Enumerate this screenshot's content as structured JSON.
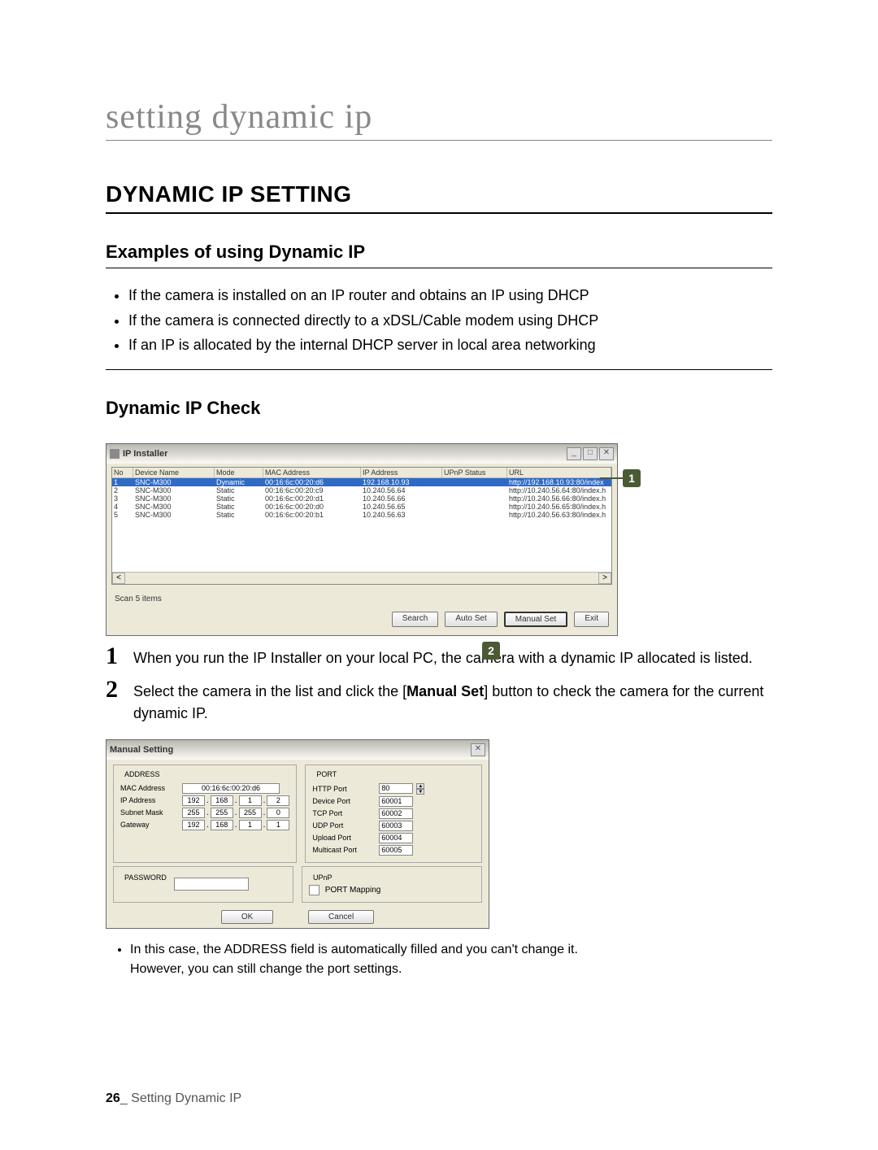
{
  "chapter_title": "setting dynamic ip",
  "section_heading": "DYNAMIC IP SETTING",
  "examples": {
    "heading": "Examples of using Dynamic IP",
    "items": [
      "If the camera is installed on an IP router and obtains an IP using DHCP",
      "If the camera is connected directly to a xDSL/Cable modem using DHCP",
      "If an IP is allocated by the internal DHCP server in local area networking"
    ]
  },
  "dynamic_check_heading": "Dynamic IP Check",
  "installer": {
    "title": "IP Installer",
    "headers": [
      "No",
      "Device Name",
      "Mode",
      "MAC Address",
      "IP Address",
      "UPnP Status",
      "URL"
    ],
    "rows": [
      {
        "no": "1",
        "name": "SNC-M300",
        "mode": "Dynamic",
        "mac": "00:16:6c:00:20:d6",
        "ip": "192.168.10.93",
        "upnp": "",
        "url": "http://192.168.10.93:80/index"
      },
      {
        "no": "2",
        "name": "SNC-M300",
        "mode": "Static",
        "mac": "00:16:6c:00:20:c9",
        "ip": "10.240.56.64",
        "upnp": "",
        "url": "http://10.240.56.64:80/index.h"
      },
      {
        "no": "3",
        "name": "SNC-M300",
        "mode": "Static",
        "mac": "00:16:6c:00:20:d1",
        "ip": "10.240.56.66",
        "upnp": "",
        "url": "http://10.240.56.66:80/index.h"
      },
      {
        "no": "4",
        "name": "SNC-M300",
        "mode": "Static",
        "mac": "00:16:6c:00:20:d0",
        "ip": "10.240.56.65",
        "upnp": "",
        "url": "http://10.240.56.65:80/index.h"
      },
      {
        "no": "5",
        "name": "SNC-M300",
        "mode": "Static",
        "mac": "00:16:6c:00:20:b1",
        "ip": "10.240.56.63",
        "upnp": "",
        "url": "http://10.240.56.63:80/index.h"
      }
    ],
    "scan_text": "Scan 5 items",
    "btn_search": "Search",
    "btn_autoset": "Auto Set",
    "btn_manualset": "Manual Set",
    "btn_exit": "Exit"
  },
  "callouts": {
    "c1": "1",
    "c2": "2"
  },
  "steps": {
    "s1": {
      "num": "1",
      "text": "When you run the IP Installer on your local PC, the camera with a dynamic IP allocated is listed."
    },
    "s2": {
      "num": "2",
      "text_before": "Select the camera in the list and click the [",
      "bold": "Manual Set",
      "text_after": "] button to check the camera for the current dynamic IP."
    }
  },
  "manual_setting": {
    "title": "Manual Setting",
    "address_legend": "ADDRESS",
    "mac_label": "MAC Address",
    "mac_val": "00:16:6c:00:20:d6",
    "ip_label": "IP Address",
    "ip_val": [
      "192",
      "168",
      "1",
      "2"
    ],
    "subnet_label": "Subnet Mask",
    "subnet_val": [
      "255",
      "255",
      "255",
      "0"
    ],
    "gateway_label": "Gateway",
    "gateway_val": [
      "192",
      "168",
      "1",
      "1"
    ],
    "port_legend": "PORT",
    "http_label": "HTTP Port",
    "http_val": "80",
    "device_label": "Device Port",
    "device_val": "60001",
    "tcp_label": "TCP Port",
    "tcp_val": "60002",
    "udp_label": "UDP Port",
    "udp_val": "60003",
    "upload_label": "Upload Port",
    "upload_val": "60004",
    "multicast_label": "Multicast Port",
    "multicast_val": "60005",
    "pw_legend": "PASSWORD",
    "upnp_legend": "UPnP",
    "port_mapping": "PORT Mapping",
    "btn_ok": "OK",
    "btn_cancel": "Cancel"
  },
  "note1": "In this case, the ADDRESS field is automatically filled and you can't change it.",
  "note2": "However, you can still change the port settings.",
  "footer": {
    "page_num": "26",
    "sep": "_ ",
    "label": "Setting Dynamic IP"
  }
}
